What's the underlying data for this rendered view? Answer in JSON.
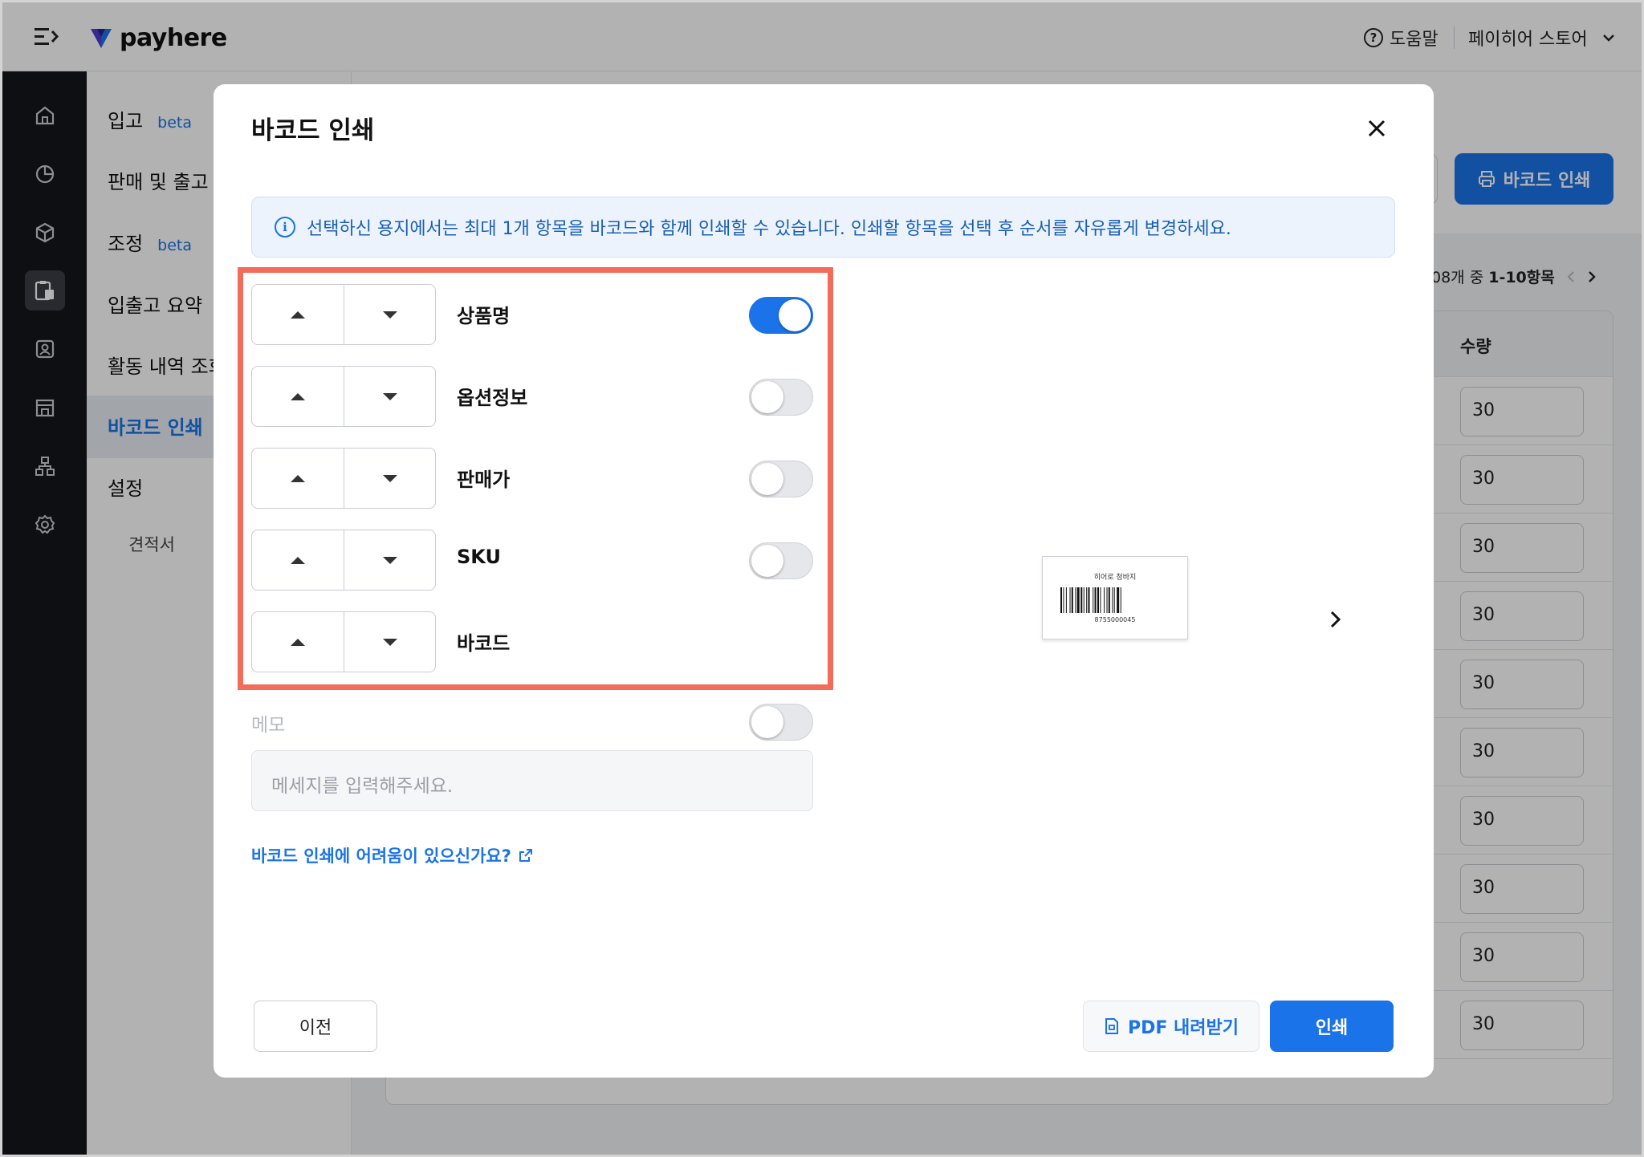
{
  "header": {
    "logo_text": "payhere",
    "help_label": "도움말",
    "store_name": "페이히어 스토어"
  },
  "subnav": {
    "items": [
      {
        "label": "입고",
        "badge": "beta"
      },
      {
        "label": "판매 및 출고",
        "badge": ""
      },
      {
        "label": "조정",
        "badge": "beta"
      },
      {
        "label": "입출고 요약",
        "badge": ""
      },
      {
        "label": "활동 내역 조회",
        "badge": ""
      },
      {
        "label": "바코드 인쇄",
        "badge": ""
      },
      {
        "label": "설정",
        "badge": ""
      }
    ],
    "sub_item": "견적서"
  },
  "background": {
    "print_button": "바코드 인쇄",
    "pager_text": "08개 중 ",
    "pager_range": "1-10항목",
    "qty_header": "수량",
    "qty_values": [
      "30",
      "30",
      "30",
      "30",
      "30",
      "30",
      "30",
      "30",
      "30",
      "30"
    ]
  },
  "modal": {
    "title": "바코드 인쇄",
    "info_text": "선택하신 용지에서는 최대 1개 항목을 바코드와 함께 인쇄할 수 있습니다. 인쇄할 항목을 선택 후 순서를 자유롭게 변경하세요.",
    "fields": [
      {
        "label": "상품명",
        "toggle": true,
        "has_toggle": true
      },
      {
        "label": "옵션정보",
        "toggle": false,
        "has_toggle": true
      },
      {
        "label": "판매가",
        "toggle": false,
        "has_toggle": true
      },
      {
        "label": "SKU",
        "toggle": false,
        "has_toggle": true
      },
      {
        "label": "바코드",
        "toggle": false,
        "has_toggle": false
      }
    ],
    "memo_label": "메모",
    "memo_placeholder": "메세지를 입력해주세요.",
    "help_link": "바코드 인쇄에 어려움이 있으신가요?",
    "preview": {
      "product_name": "히어로 청바지",
      "barcode_number": "8755000045"
    },
    "buttons": {
      "prev": "이전",
      "pdf": "PDF 내려받기",
      "print": "인쇄"
    }
  },
  "colors": {
    "accent": "#1a73e8",
    "highlight": "#f26b5b",
    "rail": "#15161a"
  }
}
